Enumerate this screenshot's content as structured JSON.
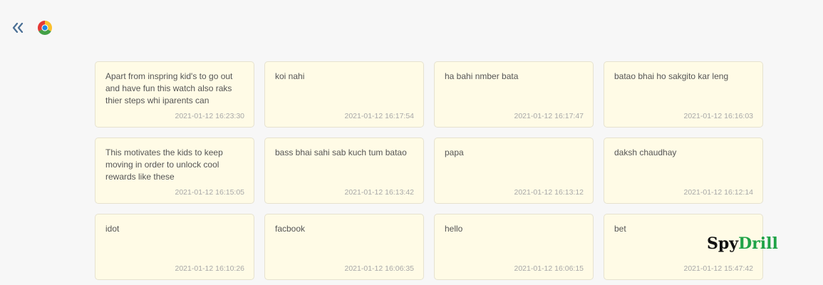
{
  "toolbar": {
    "back_icon": "double-chevron-left-icon",
    "app_icon": "chrome-icon"
  },
  "colors": {
    "card_background": "#fffbe6",
    "brand_green": "#1fa347",
    "back_icon_color": "#4a6f95"
  },
  "cards": [
    {
      "text": "Apart from inspring kid's to go out and have fun this watch also raks thier steps whi iparents can",
      "time": "2021-01-12 16:23:30"
    },
    {
      "text": "koi nahi",
      "time": "2021-01-12 16:17:54"
    },
    {
      "text": "ha bahi nmber bata",
      "time": "2021-01-12 16:17:47"
    },
    {
      "text": "batao bhai ho sakgito kar leng",
      "time": "2021-01-12 16:16:03"
    },
    {
      "text": "This motivates the kids to keep moving in order to unlock cool rewards like these",
      "time": "2021-01-12 16:15:05"
    },
    {
      "text": "bass bhai sahi sab kuch tum batao",
      "time": "2021-01-12 16:13:42"
    },
    {
      "text": "papa",
      "time": "2021-01-12 16:13:12"
    },
    {
      "text": "daksh chaudhay",
      "time": "2021-01-12 16:12:14"
    },
    {
      "text": "idot",
      "time": "2021-01-12 16:10:26"
    },
    {
      "text": "facbook",
      "time": "2021-01-12 16:06:35"
    },
    {
      "text": "hello",
      "time": "2021-01-12 16:06:15"
    },
    {
      "text": "bet",
      "time": "2021-01-12 15:47:42"
    }
  ],
  "brand": {
    "part1": "Spy",
    "part2": "Drill"
  }
}
